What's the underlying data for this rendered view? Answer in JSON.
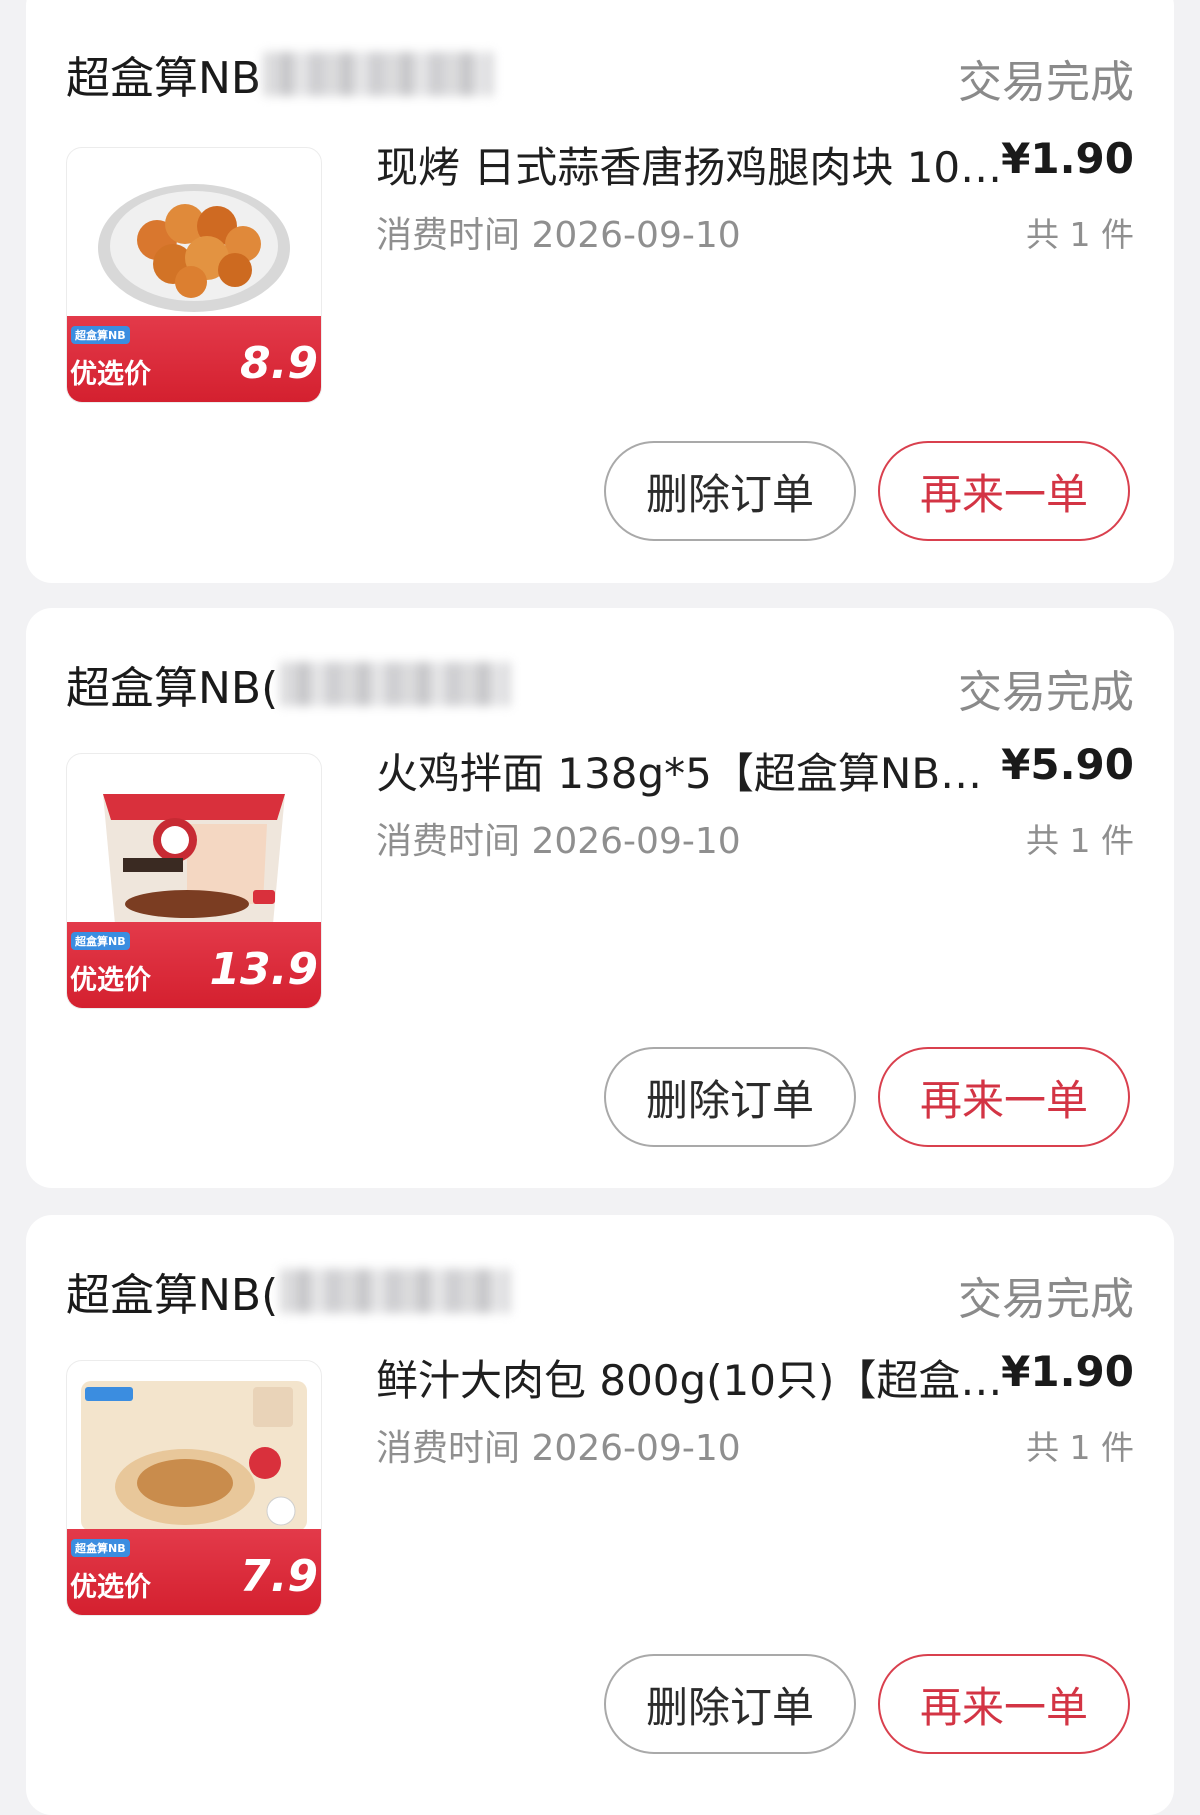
{
  "orders": [
    {
      "shop_name": "超盒算NB",
      "status": "交易完成",
      "product_title": "现烤 日式蒜香唐扬鸡腿肉块 10…",
      "price": "¥1.90",
      "consume_time": "消费时间 2026-09-10",
      "quantity": "共 1 件",
      "thumb_brand": "超盒算NB",
      "thumb_tag": "优选价",
      "thumb_price": "8.9",
      "delete_label": "删除订单",
      "reorder_label": "再来一单"
    },
    {
      "shop_name": "超盒算NB(",
      "status": "交易完成",
      "product_title": "火鸡拌面 138g*5【超盒算NB…",
      "price": "¥5.90",
      "consume_time": "消费时间 2026-09-10",
      "quantity": "共 1 件",
      "thumb_brand": "超盒算NB",
      "thumb_tag": "优选价",
      "thumb_price": "13.9",
      "delete_label": "删除订单",
      "reorder_label": "再来一单"
    },
    {
      "shop_name": "超盒算NB(",
      "status": "交易完成",
      "product_title": "鲜汁大肉包 800g(10只)【超盒…",
      "price": "¥1.90",
      "consume_time": "消费时间 2026-09-10",
      "quantity": "共 1 件",
      "thumb_brand": "超盒算NB",
      "thumb_tag": "优选价",
      "thumb_price": "7.9",
      "delete_label": "删除订单",
      "reorder_label": "再来一单"
    }
  ],
  "colors": {
    "accent_red": "#d33444",
    "status_gray": "#8a8a8a",
    "page_bg": "#f2f2f4"
  }
}
